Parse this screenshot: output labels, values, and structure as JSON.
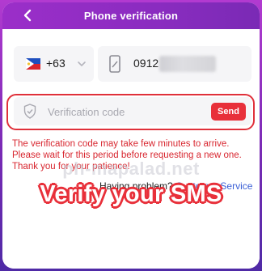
{
  "header": {
    "title": "Phone verification",
    "back_icon": "chevron-left-icon"
  },
  "phone_form": {
    "country_code": "+63",
    "country_flag": "philippines-flag",
    "dropdown_icon": "chevron-down-icon",
    "phone_icon": "phone-icon",
    "phone_prefix": "0912"
  },
  "verification": {
    "shield_icon": "shield-icon",
    "placeholder": "Verification code",
    "send_label": "Send"
  },
  "notice": "The verification code may take few minutes to arrive. Please wait for this period before requesting a new one. Thank you for your patience!",
  "watermark": "ph-mapalad.net",
  "help": {
    "prefix": "Having problem? ",
    "link": "Customer Service"
  },
  "overlay_caption": "Verify your SMS",
  "colors": {
    "header": "#8a2cc0",
    "accent": "#e8303a",
    "link": "#3a5fd6",
    "field_bg": "#f5f5f7"
  }
}
